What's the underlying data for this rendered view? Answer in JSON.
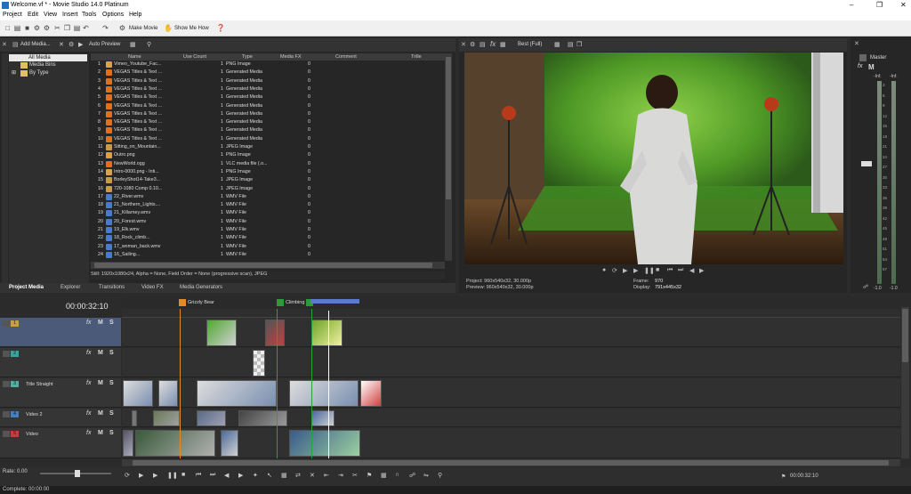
{
  "window": {
    "title": "Welcome.vf * - Movie Studio 14.0 Platinum"
  },
  "menu": [
    "Project",
    "Edit",
    "View",
    "Insert",
    "Tools",
    "Options",
    "Help"
  ],
  "toolbar": {
    "make_movie": "Make Movie",
    "show_me_how": "Show Me How"
  },
  "media_panel": {
    "add_media": "Add Media...",
    "auto_preview": "Auto Preview",
    "tree": [
      "All Media",
      "Media Bins",
      "By Type"
    ],
    "columns": [
      "Name",
      "Use Count",
      "Type",
      "Media FX",
      "Comment",
      "Trille"
    ],
    "rows": [
      {
        "n": "1",
        "name": "Vimeo_Youtube_Fac...",
        "use": "1",
        "type": "PNG Image",
        "fx": "0",
        "color": "#d9a050"
      },
      {
        "n": "2",
        "name": "VEGAS Titles & Text ...",
        "use": "1",
        "type": "Generated Media",
        "fx": "0",
        "color": "#e07020"
      },
      {
        "n": "3",
        "name": "VEGAS Titles & Text ...",
        "use": "1",
        "type": "Generated Media",
        "fx": "0",
        "color": "#e07020"
      },
      {
        "n": "4",
        "name": "VEGAS Titles & Text ...",
        "use": "1",
        "type": "Generated Media",
        "fx": "0",
        "color": "#e07020"
      },
      {
        "n": "5",
        "name": "VEGAS Titles & Text ...",
        "use": "1",
        "type": "Generated Media",
        "fx": "0",
        "color": "#e07020"
      },
      {
        "n": "6",
        "name": "VEGAS Titles & Text ...",
        "use": "1",
        "type": "Generated Media",
        "fx": "0",
        "color": "#e07020"
      },
      {
        "n": "7",
        "name": "VEGAS Titles & Text ...",
        "use": "1",
        "type": "Generated Media",
        "fx": "0",
        "color": "#e07020"
      },
      {
        "n": "8",
        "name": "VEGAS Titles & Text ...",
        "use": "1",
        "type": "Generated Media",
        "fx": "0",
        "color": "#e07020"
      },
      {
        "n": "9",
        "name": "VEGAS Titles & Text ...",
        "use": "1",
        "type": "Generated Media",
        "fx": "0",
        "color": "#e07020"
      },
      {
        "n": "10",
        "name": "VEGAS Titles & Text ...",
        "use": "1",
        "type": "Generated Media",
        "fx": "0",
        "color": "#e07020"
      },
      {
        "n": "11",
        "name": "Sitting_on_Mountain...",
        "use": "1",
        "type": "JPEG Image",
        "fx": "0",
        "color": "#c89a4a"
      },
      {
        "n": "12",
        "name": "Outro.png",
        "use": "1",
        "type": "PNG Image",
        "fx": "0",
        "color": "#d9a050"
      },
      {
        "n": "13",
        "name": "NewWorld.ogg",
        "use": "1",
        "type": "VLC media file (.o...",
        "fx": "0",
        "color": "#e07020"
      },
      {
        "n": "14",
        "name": "Intro-0000.png - Inti...",
        "use": "1",
        "type": "PNG Image",
        "fx": "0",
        "color": "#d9a050"
      },
      {
        "n": "15",
        "name": "BorleyShot14-Take3...",
        "use": "1",
        "type": "JPEG Image",
        "fx": "0",
        "color": "#c89a4a"
      },
      {
        "n": "16",
        "name": "720-1080 Comp 0.10...",
        "use": "1",
        "type": "JPEG Image",
        "fx": "0",
        "color": "#c89a4a"
      },
      {
        "n": "17",
        "name": "22_River.wmv",
        "use": "1",
        "type": "WMV File",
        "fx": "0",
        "color": "#4a7ac8"
      },
      {
        "n": "18",
        "name": "21_Northern_Lights....",
        "use": "1",
        "type": "WMV File",
        "fx": "0",
        "color": "#4a7ac8"
      },
      {
        "n": "19",
        "name": "21_Killarney.wmv",
        "use": "1",
        "type": "WMV File",
        "fx": "0",
        "color": "#4a7ac8"
      },
      {
        "n": "20",
        "name": "20_Forest.wmv",
        "use": "1",
        "type": "WMV File",
        "fx": "0",
        "color": "#4a7ac8"
      },
      {
        "n": "21",
        "name": "19_Elk.wmv",
        "use": "1",
        "type": "WMV File",
        "fx": "0",
        "color": "#4a7ac8"
      },
      {
        "n": "22",
        "name": "18_Rock_climb...",
        "use": "1",
        "type": "WMV File",
        "fx": "0",
        "color": "#4a7ac8"
      },
      {
        "n": "23",
        "name": "17_woman_back.wmv",
        "use": "1",
        "type": "WMV File",
        "fx": "0",
        "color": "#4a7ac8"
      },
      {
        "n": "24",
        "name": "16_Sailing...",
        "use": "1",
        "type": "WMV File",
        "fx": "0",
        "color": "#4a7ac8"
      }
    ],
    "status": "Still: 1920x1080x24, Alpha = None, Field Order = None (progressive scan), JPEG",
    "tabs": [
      "Project Media",
      "Explorer",
      "Transitions",
      "Video FX",
      "Media Generators"
    ]
  },
  "preview": {
    "quality": "Best (Full)",
    "project": "Project:  960x540x32, 30.000p",
    "preview": "Preview:  960x540x32, 30.000p",
    "frame_label": "Frame:",
    "frame_value": "970",
    "display_label": "Display:",
    "display_value": "791x445x32"
  },
  "master": {
    "label": "Master",
    "left_peak": "-Inf.",
    "right_peak": "-Inf.",
    "bottom_left": "-1.0",
    "bottom_right": "-1.0",
    "scale": [
      "3",
      "6",
      "9",
      "12",
      "15",
      "18",
      "21",
      "24",
      "27",
      "30",
      "33",
      "36",
      "39",
      "42",
      "45",
      "48",
      "51",
      "54",
      "57"
    ]
  },
  "timeline": {
    "timecode": "00:00:32:10",
    "markers": [
      "Grizzly Bear",
      "Climbing"
    ],
    "tracks": [
      {
        "num": "1",
        "name": "",
        "color": "#c8a040"
      },
      {
        "num": "2",
        "name": "",
        "color": "#40a0a0"
      },
      {
        "num": "3",
        "name": "Title Straight",
        "color": "#50b0a0"
      },
      {
        "num": "4",
        "name": "Video 2",
        "color": "#4080c0"
      },
      {
        "num": "5",
        "name": "Video",
        "color": "#c04040"
      }
    ],
    "rate": "Rate: 0.00",
    "end_timecode": "00:00:32:10",
    "status": "Complete: 00:00:00"
  },
  "colors": {
    "accent": "#3a78c8",
    "panel": "#262626",
    "greenscreen": "#5aa82a"
  }
}
